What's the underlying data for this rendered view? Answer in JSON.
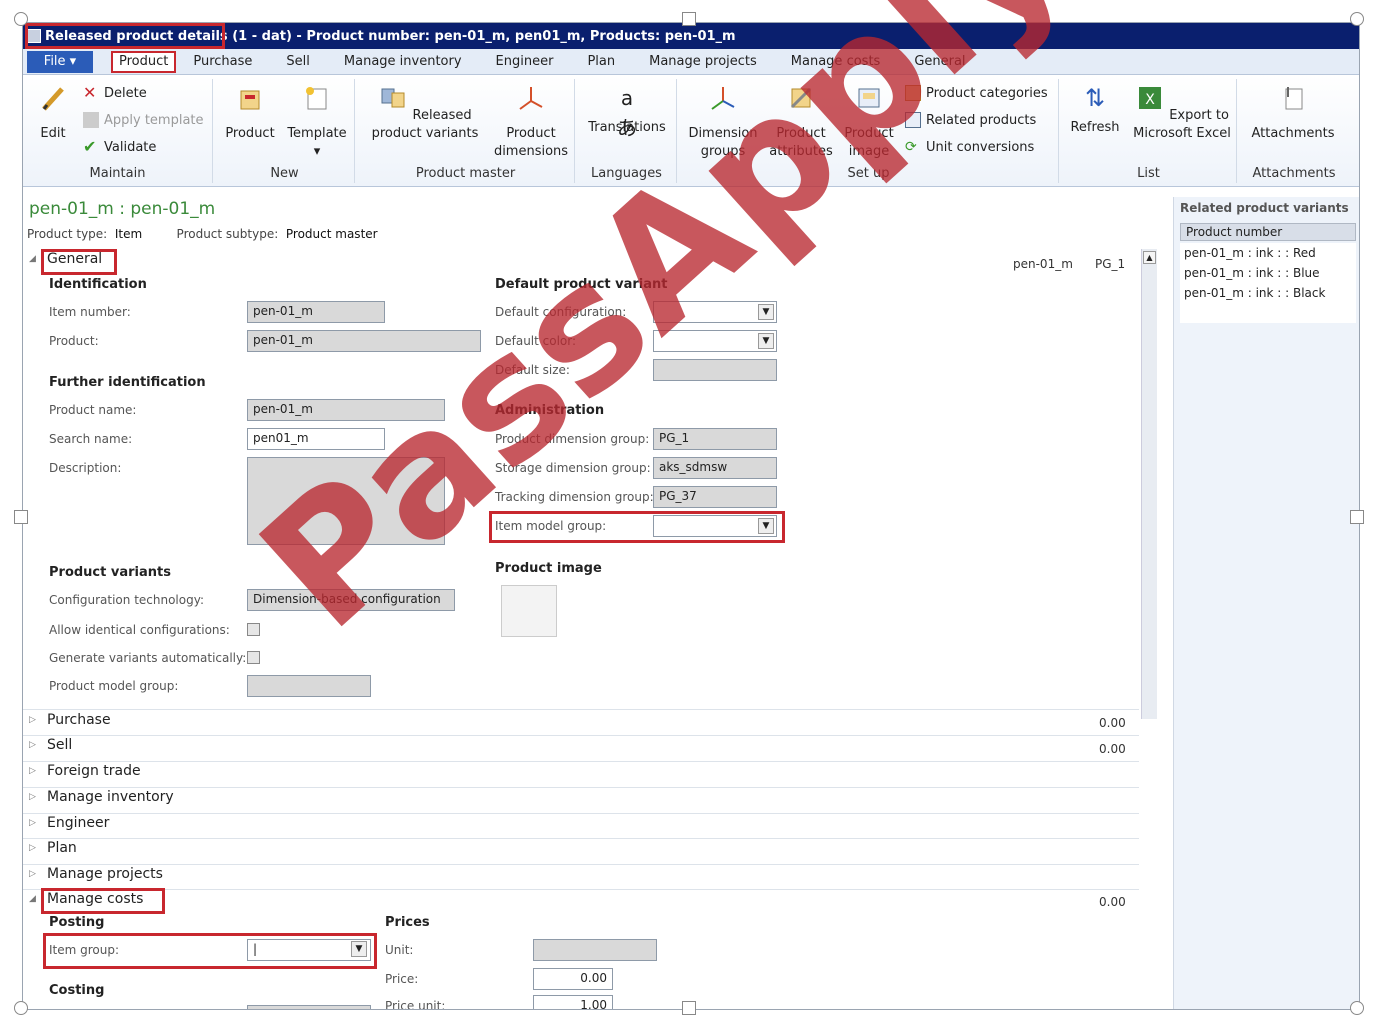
{
  "window": {
    "title_prefix": "Released product details",
    "title_rest": "(1 - dat) - Product number: pen-01_m, pen01_m, Products: pen-01_m"
  },
  "menu_tabs": {
    "file": "File",
    "items": [
      "Product",
      "Purchase",
      "Sell",
      "Manage inventory",
      "Engineer",
      "Plan",
      "Manage projects",
      "Manage costs",
      "General"
    ]
  },
  "ribbon": {
    "maintain": {
      "edit": "Edit",
      "delete": "Delete",
      "apply_template": "Apply template",
      "validate": "Validate",
      "label": "Maintain"
    },
    "new": {
      "product": "Product",
      "template": "Template",
      "label": "New"
    },
    "product_master": {
      "released_variants": "Released product variants",
      "dimensions": "Product dimensions",
      "label": "Product master"
    },
    "languages": {
      "translations": "Translations",
      "label": "Languages"
    },
    "setup": {
      "dimension_groups": "Dimension groups",
      "attributes": "Product attributes",
      "image": "Product image",
      "categories": "Product categories",
      "related": "Related products",
      "unit_conversions": "Unit conversions",
      "label": "Set up"
    },
    "list": {
      "refresh": "Refresh",
      "export": "Export to Microsoft Excel",
      "label": "List"
    },
    "attachments": {
      "attachments": "Attachments",
      "label": "Attachments"
    }
  },
  "header": {
    "product_title": "pen-01_m : pen-01_m",
    "product_type_label": "Product type:",
    "product_type_value": "Item",
    "product_subtype_label": "Product subtype:",
    "product_subtype_value": "Product master"
  },
  "general": {
    "tab": "General",
    "summary1": "pen-01_m",
    "summary2": "PG_1",
    "identification": {
      "title": "Identification",
      "item_number_label": "Item number:",
      "item_number": "pen-01_m",
      "product_label": "Product:",
      "product": "pen-01_m"
    },
    "further": {
      "title": "Further identification",
      "product_name_label": "Product name:",
      "product_name": "pen-01_m",
      "search_name_label": "Search name:",
      "search_name": "pen01_m",
      "description_label": "Description:"
    },
    "variants": {
      "title": "Product variants",
      "config_tech_label": "Configuration technology:",
      "config_tech": "Dimension-based configuration",
      "allow_identical_label": "Allow identical configurations:",
      "generate_auto_label": "Generate variants automatically:",
      "model_group_label": "Product model group:"
    },
    "default_variant": {
      "title": "Default product variant",
      "config_label": "Default configuration:",
      "color_label": "Default color:",
      "size_label": "Default size:"
    },
    "administration": {
      "title": "Administration",
      "dim_group_label": "Product dimension group:",
      "dim_group": "PG_1",
      "storage_label": "Storage dimension group:",
      "storage": "aks_sdmsw",
      "tracking_label": "Tracking dimension group:",
      "tracking": "PG_37",
      "item_model_label": "Item model group:"
    },
    "image": {
      "title": "Product image"
    }
  },
  "fasttabs": {
    "purchase": {
      "label": "Purchase",
      "value": "0.00"
    },
    "sell": {
      "label": "Sell",
      "value": "0.00"
    },
    "foreign_trade": "Foreign trade",
    "manage_inventory": "Manage inventory",
    "engineer": "Engineer",
    "plan": "Plan",
    "manage_projects": "Manage projects",
    "manage_costs": {
      "label": "Manage costs",
      "value": "0.00"
    }
  },
  "manage_costs": {
    "posting_title": "Posting",
    "item_group_label": "Item group:",
    "item_group_value": "|",
    "costing_title": "Costing",
    "prices_title": "Prices",
    "unit_label": "Unit:",
    "price_label": "Price:",
    "price": "0.00",
    "price_unit_label": "Price unit:",
    "price_unit": "1.00"
  },
  "related_variants": {
    "title": "Related product variants",
    "column": "Product number",
    "items": [
      "pen-01_m : ink : : Red",
      "pen-01_m : ink : : Blue",
      "pen-01_m : ink : : Black"
    ]
  },
  "watermark": "PassApply.com",
  "colors": {
    "title_bar": "#0a1f6e",
    "file_tab": "#2b5cb8",
    "highlight": "#c8272e",
    "heading_green": "#3a8a3a"
  }
}
